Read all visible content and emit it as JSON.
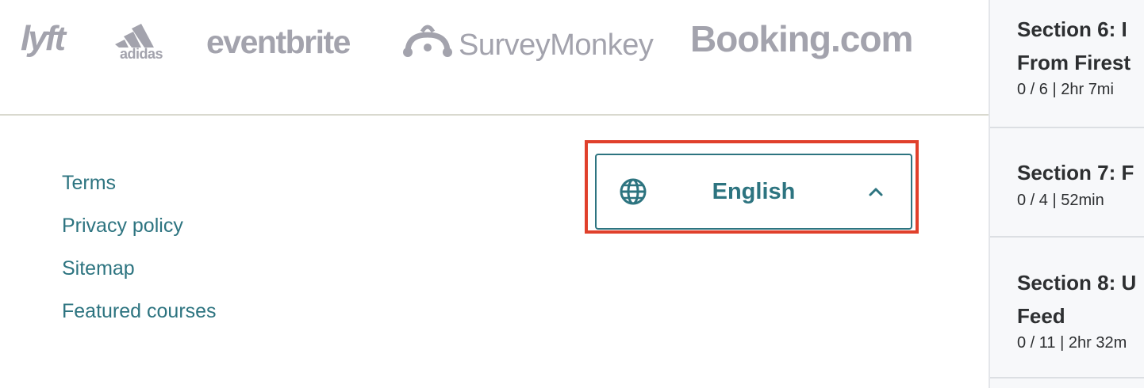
{
  "logos": {
    "lyft": "lyft",
    "adidas": "adidas",
    "eventbrite": "eventbrite",
    "surveymonkey": "SurveyMonkey",
    "booking": "Booking.com"
  },
  "footer": {
    "links": [
      {
        "label": "Terms"
      },
      {
        "label": "Privacy policy"
      },
      {
        "label": "Sitemap"
      },
      {
        "label": "Featured courses"
      }
    ]
  },
  "language_selector": {
    "label": "English",
    "icon": "globe-icon",
    "chevron": "chevron-up-icon",
    "highlight_color": "#e0402b",
    "accent_color": "#2d7480"
  },
  "sidebar": {
    "sections": [
      {
        "title": "Section 6: I… From Firest…",
        "title_line1": "Section 6: I",
        "title_line2": "From Firest",
        "meta": "0 / 6 | 2hr 7mi"
      },
      {
        "title": "Section 7: F",
        "title_line1": "Section 7: F",
        "meta": "0 / 4 | 52min"
      },
      {
        "title": "Section 8: U… Feed",
        "title_line1": "Section 8: U",
        "title_line2": "Feed",
        "meta": "0 / 11 | 2hr 32m"
      }
    ]
  }
}
